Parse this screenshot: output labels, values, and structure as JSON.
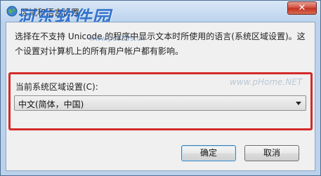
{
  "window": {
    "title": "区域和语言设置",
    "close_label": "✕"
  },
  "watermark": {
    "logo_text": "河东软件园",
    "site_small": "www.pc0359.cn",
    "site_big": "www.pHome.NET"
  },
  "description": {
    "line1": "选择在不支持 Unicode 的程序中显示文本时所使用的语言(系统区域设置)。这",
    "line2": "个设置对计算机上的所有用户帐户都有影响。"
  },
  "locale": {
    "label": "当前系统区域设置(C):",
    "selected": "中文(简体，中国)"
  },
  "buttons": {
    "ok_label": "确定",
    "cancel_label": "取消"
  },
  "colors": {
    "highlight": "#d42a2a",
    "close": "#c1301f"
  },
  "icons": {
    "title_icon": "globe-icon",
    "dropdown": "chevron-down-icon"
  }
}
